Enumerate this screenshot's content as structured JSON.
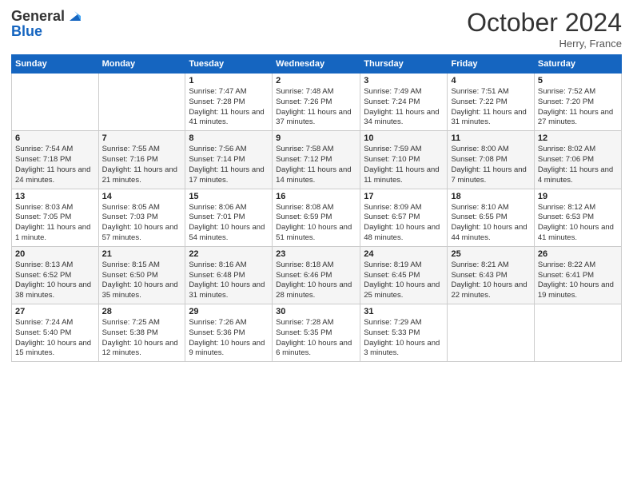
{
  "header": {
    "logo_line1": "General",
    "logo_line2": "Blue",
    "month_title": "October 2024",
    "location": "Herry, France"
  },
  "weekdays": [
    "Sunday",
    "Monday",
    "Tuesday",
    "Wednesday",
    "Thursday",
    "Friday",
    "Saturday"
  ],
  "weeks": [
    [
      {
        "day": "",
        "sunrise": "",
        "sunset": "",
        "daylight": ""
      },
      {
        "day": "",
        "sunrise": "",
        "sunset": "",
        "daylight": ""
      },
      {
        "day": "1",
        "sunrise": "Sunrise: 7:47 AM",
        "sunset": "Sunset: 7:28 PM",
        "daylight": "Daylight: 11 hours and 41 minutes."
      },
      {
        "day": "2",
        "sunrise": "Sunrise: 7:48 AM",
        "sunset": "Sunset: 7:26 PM",
        "daylight": "Daylight: 11 hours and 37 minutes."
      },
      {
        "day": "3",
        "sunrise": "Sunrise: 7:49 AM",
        "sunset": "Sunset: 7:24 PM",
        "daylight": "Daylight: 11 hours and 34 minutes."
      },
      {
        "day": "4",
        "sunrise": "Sunrise: 7:51 AM",
        "sunset": "Sunset: 7:22 PM",
        "daylight": "Daylight: 11 hours and 31 minutes."
      },
      {
        "day": "5",
        "sunrise": "Sunrise: 7:52 AM",
        "sunset": "Sunset: 7:20 PM",
        "daylight": "Daylight: 11 hours and 27 minutes."
      }
    ],
    [
      {
        "day": "6",
        "sunrise": "Sunrise: 7:54 AM",
        "sunset": "Sunset: 7:18 PM",
        "daylight": "Daylight: 11 hours and 24 minutes."
      },
      {
        "day": "7",
        "sunrise": "Sunrise: 7:55 AM",
        "sunset": "Sunset: 7:16 PM",
        "daylight": "Daylight: 11 hours and 21 minutes."
      },
      {
        "day": "8",
        "sunrise": "Sunrise: 7:56 AM",
        "sunset": "Sunset: 7:14 PM",
        "daylight": "Daylight: 11 hours and 17 minutes."
      },
      {
        "day": "9",
        "sunrise": "Sunrise: 7:58 AM",
        "sunset": "Sunset: 7:12 PM",
        "daylight": "Daylight: 11 hours and 14 minutes."
      },
      {
        "day": "10",
        "sunrise": "Sunrise: 7:59 AM",
        "sunset": "Sunset: 7:10 PM",
        "daylight": "Daylight: 11 hours and 11 minutes."
      },
      {
        "day": "11",
        "sunrise": "Sunrise: 8:00 AM",
        "sunset": "Sunset: 7:08 PM",
        "daylight": "Daylight: 11 hours and 7 minutes."
      },
      {
        "day": "12",
        "sunrise": "Sunrise: 8:02 AM",
        "sunset": "Sunset: 7:06 PM",
        "daylight": "Daylight: 11 hours and 4 minutes."
      }
    ],
    [
      {
        "day": "13",
        "sunrise": "Sunrise: 8:03 AM",
        "sunset": "Sunset: 7:05 PM",
        "daylight": "Daylight: 11 hours and 1 minute."
      },
      {
        "day": "14",
        "sunrise": "Sunrise: 8:05 AM",
        "sunset": "Sunset: 7:03 PM",
        "daylight": "Daylight: 10 hours and 57 minutes."
      },
      {
        "day": "15",
        "sunrise": "Sunrise: 8:06 AM",
        "sunset": "Sunset: 7:01 PM",
        "daylight": "Daylight: 10 hours and 54 minutes."
      },
      {
        "day": "16",
        "sunrise": "Sunrise: 8:08 AM",
        "sunset": "Sunset: 6:59 PM",
        "daylight": "Daylight: 10 hours and 51 minutes."
      },
      {
        "day": "17",
        "sunrise": "Sunrise: 8:09 AM",
        "sunset": "Sunset: 6:57 PM",
        "daylight": "Daylight: 10 hours and 48 minutes."
      },
      {
        "day": "18",
        "sunrise": "Sunrise: 8:10 AM",
        "sunset": "Sunset: 6:55 PM",
        "daylight": "Daylight: 10 hours and 44 minutes."
      },
      {
        "day": "19",
        "sunrise": "Sunrise: 8:12 AM",
        "sunset": "Sunset: 6:53 PM",
        "daylight": "Daylight: 10 hours and 41 minutes."
      }
    ],
    [
      {
        "day": "20",
        "sunrise": "Sunrise: 8:13 AM",
        "sunset": "Sunset: 6:52 PM",
        "daylight": "Daylight: 10 hours and 38 minutes."
      },
      {
        "day": "21",
        "sunrise": "Sunrise: 8:15 AM",
        "sunset": "Sunset: 6:50 PM",
        "daylight": "Daylight: 10 hours and 35 minutes."
      },
      {
        "day": "22",
        "sunrise": "Sunrise: 8:16 AM",
        "sunset": "Sunset: 6:48 PM",
        "daylight": "Daylight: 10 hours and 31 minutes."
      },
      {
        "day": "23",
        "sunrise": "Sunrise: 8:18 AM",
        "sunset": "Sunset: 6:46 PM",
        "daylight": "Daylight: 10 hours and 28 minutes."
      },
      {
        "day": "24",
        "sunrise": "Sunrise: 8:19 AM",
        "sunset": "Sunset: 6:45 PM",
        "daylight": "Daylight: 10 hours and 25 minutes."
      },
      {
        "day": "25",
        "sunrise": "Sunrise: 8:21 AM",
        "sunset": "Sunset: 6:43 PM",
        "daylight": "Daylight: 10 hours and 22 minutes."
      },
      {
        "day": "26",
        "sunrise": "Sunrise: 8:22 AM",
        "sunset": "Sunset: 6:41 PM",
        "daylight": "Daylight: 10 hours and 19 minutes."
      }
    ],
    [
      {
        "day": "27",
        "sunrise": "Sunrise: 7:24 AM",
        "sunset": "Sunset: 5:40 PM",
        "daylight": "Daylight: 10 hours and 15 minutes."
      },
      {
        "day": "28",
        "sunrise": "Sunrise: 7:25 AM",
        "sunset": "Sunset: 5:38 PM",
        "daylight": "Daylight: 10 hours and 12 minutes."
      },
      {
        "day": "29",
        "sunrise": "Sunrise: 7:26 AM",
        "sunset": "Sunset: 5:36 PM",
        "daylight": "Daylight: 10 hours and 9 minutes."
      },
      {
        "day": "30",
        "sunrise": "Sunrise: 7:28 AM",
        "sunset": "Sunset: 5:35 PM",
        "daylight": "Daylight: 10 hours and 6 minutes."
      },
      {
        "day": "31",
        "sunrise": "Sunrise: 7:29 AM",
        "sunset": "Sunset: 5:33 PM",
        "daylight": "Daylight: 10 hours and 3 minutes."
      },
      {
        "day": "",
        "sunrise": "",
        "sunset": "",
        "daylight": ""
      },
      {
        "day": "",
        "sunrise": "",
        "sunset": "",
        "daylight": ""
      }
    ]
  ]
}
